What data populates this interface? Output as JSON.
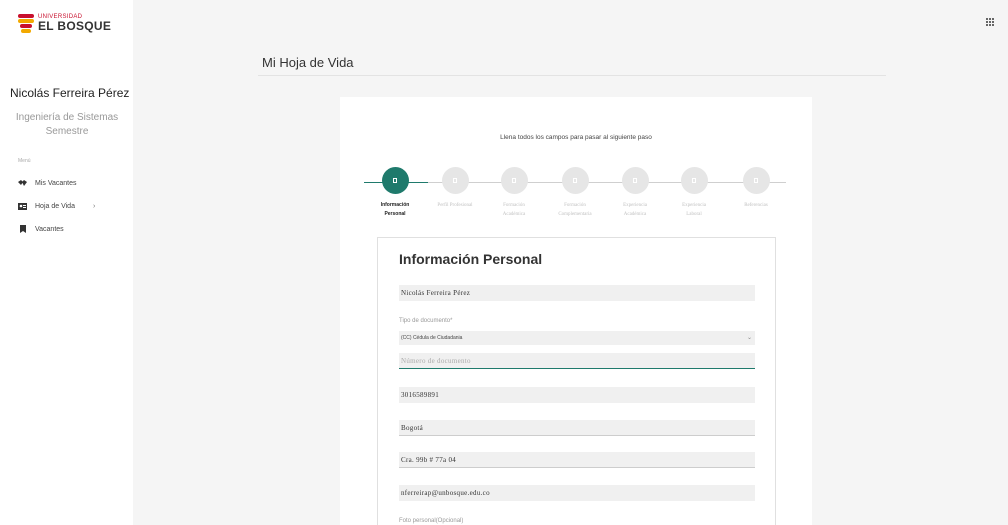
{
  "brand": {
    "small": "UNIVERSIDAD",
    "big": "EL BOSQUE"
  },
  "profile": {
    "name": "Nicolás Ferreira Pérez",
    "career": "Ingeniería de Sistemas",
    "semester": "Semestre"
  },
  "menu": {
    "heading": "Menú",
    "items": [
      {
        "label": "Mis Vacantes",
        "icon": "handshake-icon"
      },
      {
        "label": "Hoja de Vida",
        "icon": "id-card-icon"
      },
      {
        "label": "Vacantes",
        "icon": "bookmark-icon"
      }
    ]
  },
  "header": {
    "title": "Mi Hoja de Vida"
  },
  "wizard": {
    "instruction": "Llena todos los campos para pasar al siguiente paso",
    "steps": [
      {
        "line1": "Información",
        "line2": "Personal"
      },
      {
        "line1": "Perfil Profesional",
        "line2": ""
      },
      {
        "line1": "Formación",
        "line2": "Académica"
      },
      {
        "line1": "Formación",
        "line2": "Complementaria"
      },
      {
        "line1": "Experiencia",
        "line2": "Académica"
      },
      {
        "line1": "Experiencia",
        "line2": "Laboral"
      },
      {
        "line1": "Referencias",
        "line2": ""
      }
    ],
    "active_step": 1
  },
  "form": {
    "title": "Información Personal",
    "full_name": "Nicolás Ferreira Pérez",
    "doc_type_label": "Tipo de documento*",
    "doc_type_value": "(CC) Cédula de Ciudadania",
    "doc_number_placeholder": "Número de documento",
    "phone": "3016589891",
    "city": "Bogotá",
    "address": "Cra. 99b # 77a 04",
    "email": "nferreirap@unbosque.edu.co",
    "photo_label": "Foto personal(Opcional)"
  },
  "colors": {
    "accent": "#1f7a6c",
    "brand_red": "#c8102e",
    "brand_gold": "#f2a900"
  }
}
